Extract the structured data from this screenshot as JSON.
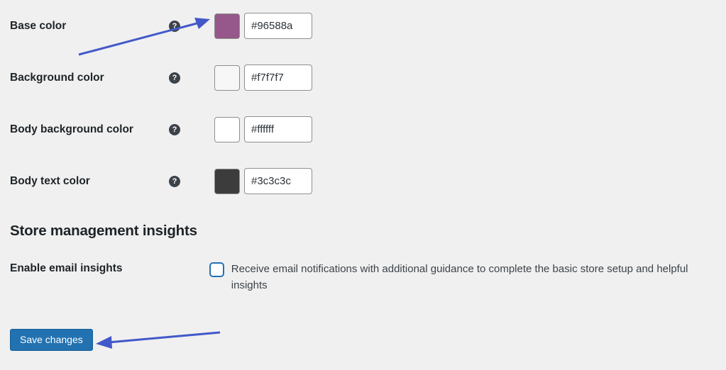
{
  "colors": [
    {
      "label": "Base color",
      "value": "#96588a",
      "swatch": "#96588a"
    },
    {
      "label": "Background color",
      "value": "#f7f7f7",
      "swatch": "#f7f7f7"
    },
    {
      "label": "Body background color",
      "value": "#ffffff",
      "swatch": "#ffffff"
    },
    {
      "label": "Body text color",
      "value": "#3c3c3c",
      "swatch": "#3c3c3c"
    }
  ],
  "section_title": "Store management insights",
  "insights": {
    "label": "Enable email insights",
    "description": "Receive email notifications with additional guidance to complete the basic store setup and helpful insights"
  },
  "save_label": "Save changes"
}
